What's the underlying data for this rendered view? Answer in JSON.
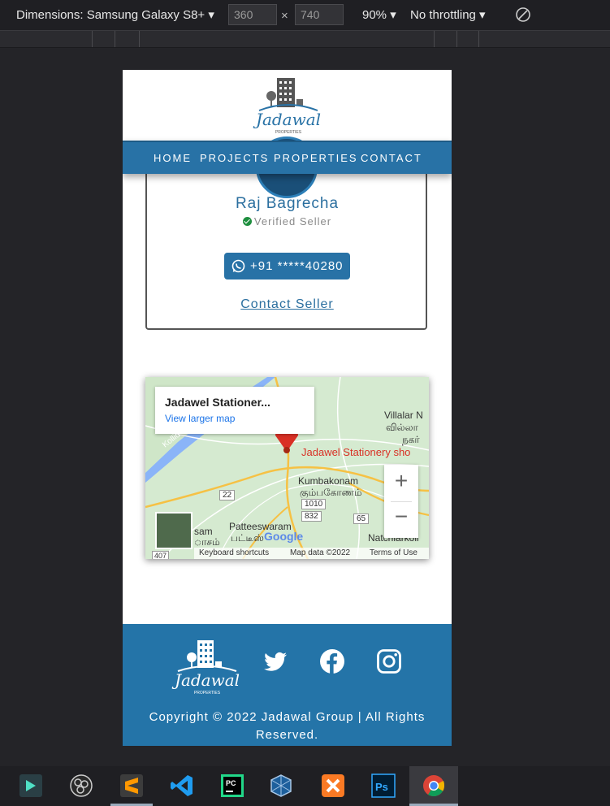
{
  "devtools": {
    "dimensions_label": "Dimensions: Samsung Galaxy S8+",
    "width_value": "360",
    "times": "×",
    "height_value": "740",
    "zoom": "90%",
    "throttling": "No throttling"
  },
  "site": {
    "brand": "Jadawal",
    "brand_sub": "PROPERTIES",
    "nav": [
      "HOME",
      "PROJECTS",
      "PROPERTIES",
      "CONTACT"
    ],
    "seller": {
      "name": "Raj Bagrecha",
      "verified": "Verified Seller",
      "phone": "+91 *****40280",
      "contact_link": "Contact Seller"
    },
    "map": {
      "place_title": "Jadawel Stationer...",
      "view_larger": "View larger map",
      "pin_label": "Jadawel Stationery sho",
      "labels": {
        "villalar": "Villalar N",
        "villalar_ta": "வில்லா",
        "nagar_ta": "நகர்",
        "kumbakonam": "Kumbakonam",
        "kumbakonam_ta": "கும்பகோணம்",
        "patteeswaram": "Patteeswaram",
        "patteeswaram_ta": "பட்டீஸ்",
        "natchiarkoil": "Natchiarkoil",
        "sam": "sam",
        "sam_ta": "ாசம்",
        "route_22": "22",
        "route_1010": "1010",
        "route_832": "832",
        "route_65": "65",
        "route_407": "407",
        "kollidam": "Kollid"
      },
      "zoom_in": "+",
      "zoom_out": "−",
      "google": "Google",
      "keyboard_shortcuts": "Keyboard shortcuts",
      "map_data": "Map data ©2022",
      "terms": "Terms of Use"
    },
    "footer": {
      "copyright": "Copyright © 2022 Jadawal Group | All Rights Reserved."
    }
  },
  "taskbar": {
    "apps": [
      "filmora-icon",
      "obs-icon",
      "sublime-icon",
      "vscode-icon",
      "pycharm-icon",
      "virtualbox-icon",
      "xampp-icon",
      "photoshop-icon",
      "chrome-icon"
    ]
  },
  "colors": {
    "brand_blue": "#2872a6",
    "footer_blue": "#2474a8",
    "pin_red": "#d93025"
  }
}
